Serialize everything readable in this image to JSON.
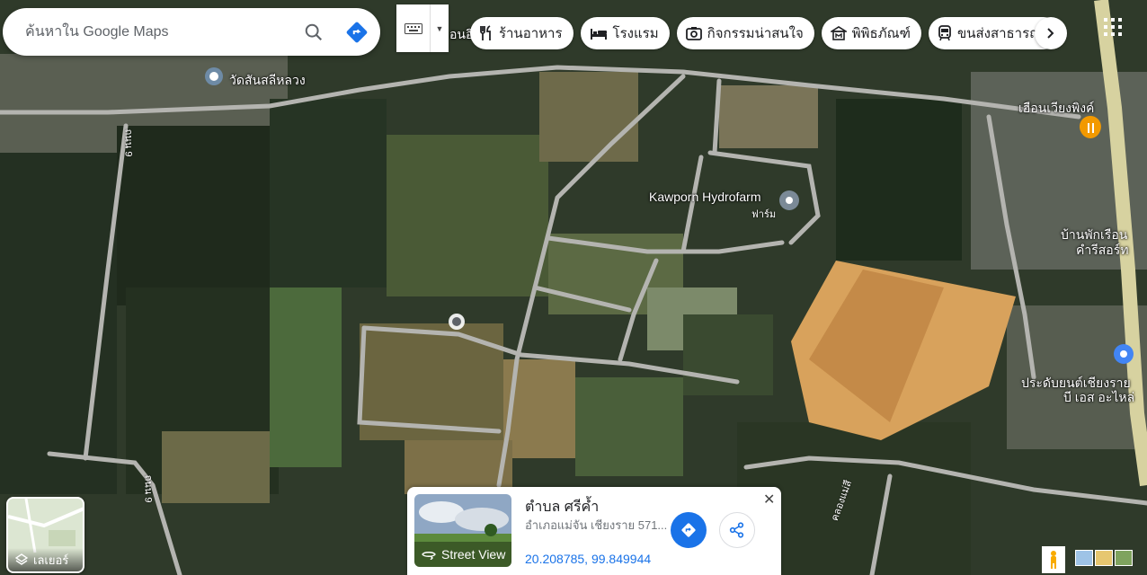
{
  "search": {
    "placeholder": "ค้นหาใน Google Maps"
  },
  "chips": [
    {
      "label": "ร้านอาหาร",
      "icon": "fork-knife-icon"
    },
    {
      "label": "โรงแรม",
      "icon": "bed-icon"
    },
    {
      "label": "กิจกรรมน่าสนใจ",
      "icon": "camera-icon"
    },
    {
      "label": "พิพิธภัณฑ์",
      "icon": "museum-icon"
    },
    {
      "label": "ขนส่งสาธารณะ",
      "icon": "transit-icon"
    }
  ],
  "places": {
    "temple": "วัดสันสลีหลวง",
    "farm_name": "Kawporn Hydrofarm",
    "farm_type": "ฟาร์ม",
    "restaurant": "เฮือนเวียงพิงค์",
    "guesthouse_line1": "บ้านพักเรือน",
    "guesthouse_line2": "คำรีสอร์ท",
    "insurance_line1": "ประดับยนต์เชียงราย",
    "insurance_line2": "บี เอส อะไหล่",
    "top_partial": "อนอิ"
  },
  "roads": {
    "road_left": "ถนน 9",
    "road_left2": "ถนน 9",
    "canal": "คลองแม่สี"
  },
  "layers": {
    "label": "เลเยอร์"
  },
  "info_card": {
    "title": "ตำบล ศรีค้ำ",
    "address": "อำเภอแม่จัน เชียงราย 571...",
    "coordinates": "20.208785, 99.849944",
    "street_view_label": "Street View"
  },
  "colors": {
    "accent": "#1a73e8",
    "road": "#b4b4b0"
  }
}
